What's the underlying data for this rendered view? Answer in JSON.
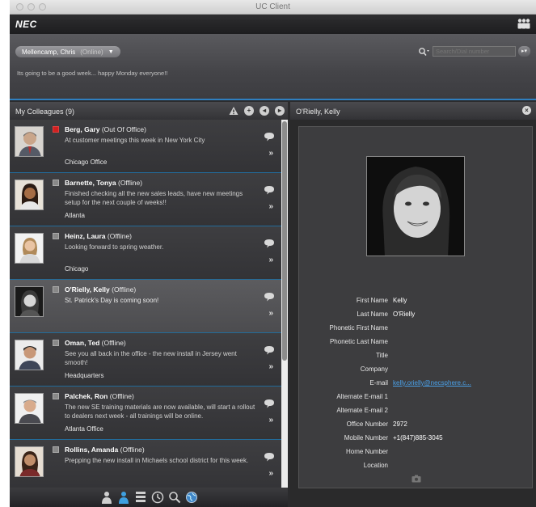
{
  "window": {
    "title": "UC Client"
  },
  "topbar": {
    "logo": "NEC"
  },
  "header": {
    "user_name": "Mellencamp, Chris",
    "user_status": "(Online)",
    "status_message": "Its going to be a good week... happy Monday everyone!!",
    "search_placeholder": "Search/Dial number"
  },
  "colleagues": {
    "title": "My Colleagues (9)",
    "items": [
      {
        "name": "Berg, Gary",
        "status": "(Out Of Office)",
        "message": "At customer meetings this week in New York City",
        "location": "Chicago Office",
        "presence": "away"
      },
      {
        "name": "Barnette, Tonya",
        "status": "(Offline)",
        "message": "Finished checking all the new sales leads, have new meetings setup for the next couple of weeks!!",
        "location": "Atlanta",
        "presence": "offline"
      },
      {
        "name": "Heinz, Laura",
        "status": "(Offline)",
        "message": "Looking forward to spring weather.",
        "location": "Chicago",
        "presence": "offline"
      },
      {
        "name": "O'Rielly, Kelly",
        "status": "(Offline)",
        "message": "St. Patrick's Day is coming soon!",
        "location": "",
        "presence": "offline"
      },
      {
        "name": "Oman, Ted",
        "status": "(Offline)",
        "message": "See you all back in the office - the new install in Jersey went smooth!",
        "location": "Headquarters",
        "presence": "offline"
      },
      {
        "name": "Palchek, Ron",
        "status": "(Offline)",
        "message": "The new SE training materials are now available, will start a rollout to dealers next  week - all trainings will be online.",
        "location": "Atlanta Office",
        "presence": "offline"
      },
      {
        "name": "Rollins, Amanda",
        "status": "(Offline)",
        "message": "Prepping the new install in Michaels school district for this week.",
        "location": "",
        "presence": "offline"
      }
    ]
  },
  "detail": {
    "title": "O'Rielly, Kelly",
    "fields": [
      {
        "label": "First Name",
        "value": "Kelly"
      },
      {
        "label": "Last Name",
        "value": "O'Rielly"
      },
      {
        "label": "Phonetic First Name",
        "value": ""
      },
      {
        "label": "Phonetic Last Name",
        "value": ""
      },
      {
        "label": "Title",
        "value": ""
      },
      {
        "label": "Company",
        "value": ""
      },
      {
        "label": "E-mail",
        "value": "kelly.orielly@necsphere.c..."
      },
      {
        "label": "Alternate E-mail 1",
        "value": ""
      },
      {
        "label": "Alternate E-mail 2",
        "value": ""
      },
      {
        "label": "Office Number",
        "value": "2972"
      },
      {
        "label": "Mobile Number",
        "value": "+1(847)885-3045"
      },
      {
        "label": "Home Number",
        "value": ""
      },
      {
        "label": "Location",
        "value": ""
      }
    ]
  },
  "colors": {
    "accent": "#2f7fbf",
    "link": "#4aa0e8",
    "away": "#d02020"
  }
}
